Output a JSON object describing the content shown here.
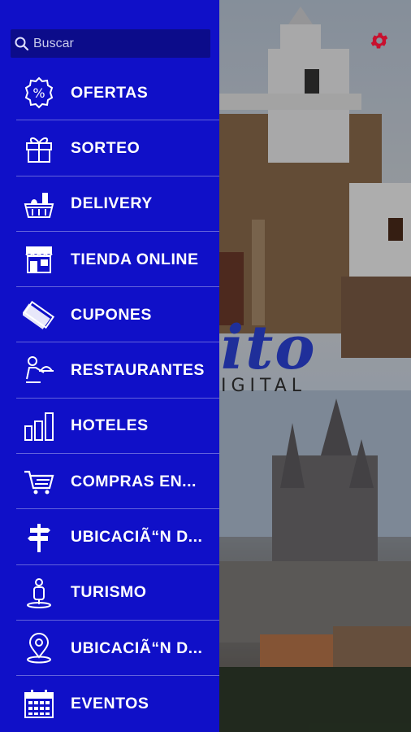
{
  "search": {
    "placeholder": "Buscar"
  },
  "brand": {
    "word": "ito",
    "subtitle": "IGITAL"
  },
  "menu": [
    {
      "label": "OFERTAS",
      "icon": "percent-icon"
    },
    {
      "label": "SORTEO",
      "icon": "gift-icon"
    },
    {
      "label": "DELIVERY",
      "icon": "basket-icon"
    },
    {
      "label": "TIENDA ONLINE",
      "icon": "store-icon"
    },
    {
      "label": "CUPONES",
      "icon": "coupon-icon"
    },
    {
      "label": "RESTAURANTES",
      "icon": "waiter-icon"
    },
    {
      "label": "HOTELES",
      "icon": "buildings-icon"
    },
    {
      "label": "COMPRAS EN...",
      "icon": "cart-icon"
    },
    {
      "label": "UBICACIÃ“N D...",
      "icon": "signpost-icon"
    },
    {
      "label": "TURISMO",
      "icon": "tourist-icon"
    },
    {
      "label": "UBICACIÃ“N D...",
      "icon": "location-pin-icon"
    },
    {
      "label": "EVENTOS",
      "icon": "calendar-icon"
    }
  ],
  "colors": {
    "drawer": "#1010c8",
    "search_bg": "#0c0c8a",
    "gear": "#c8102e"
  }
}
